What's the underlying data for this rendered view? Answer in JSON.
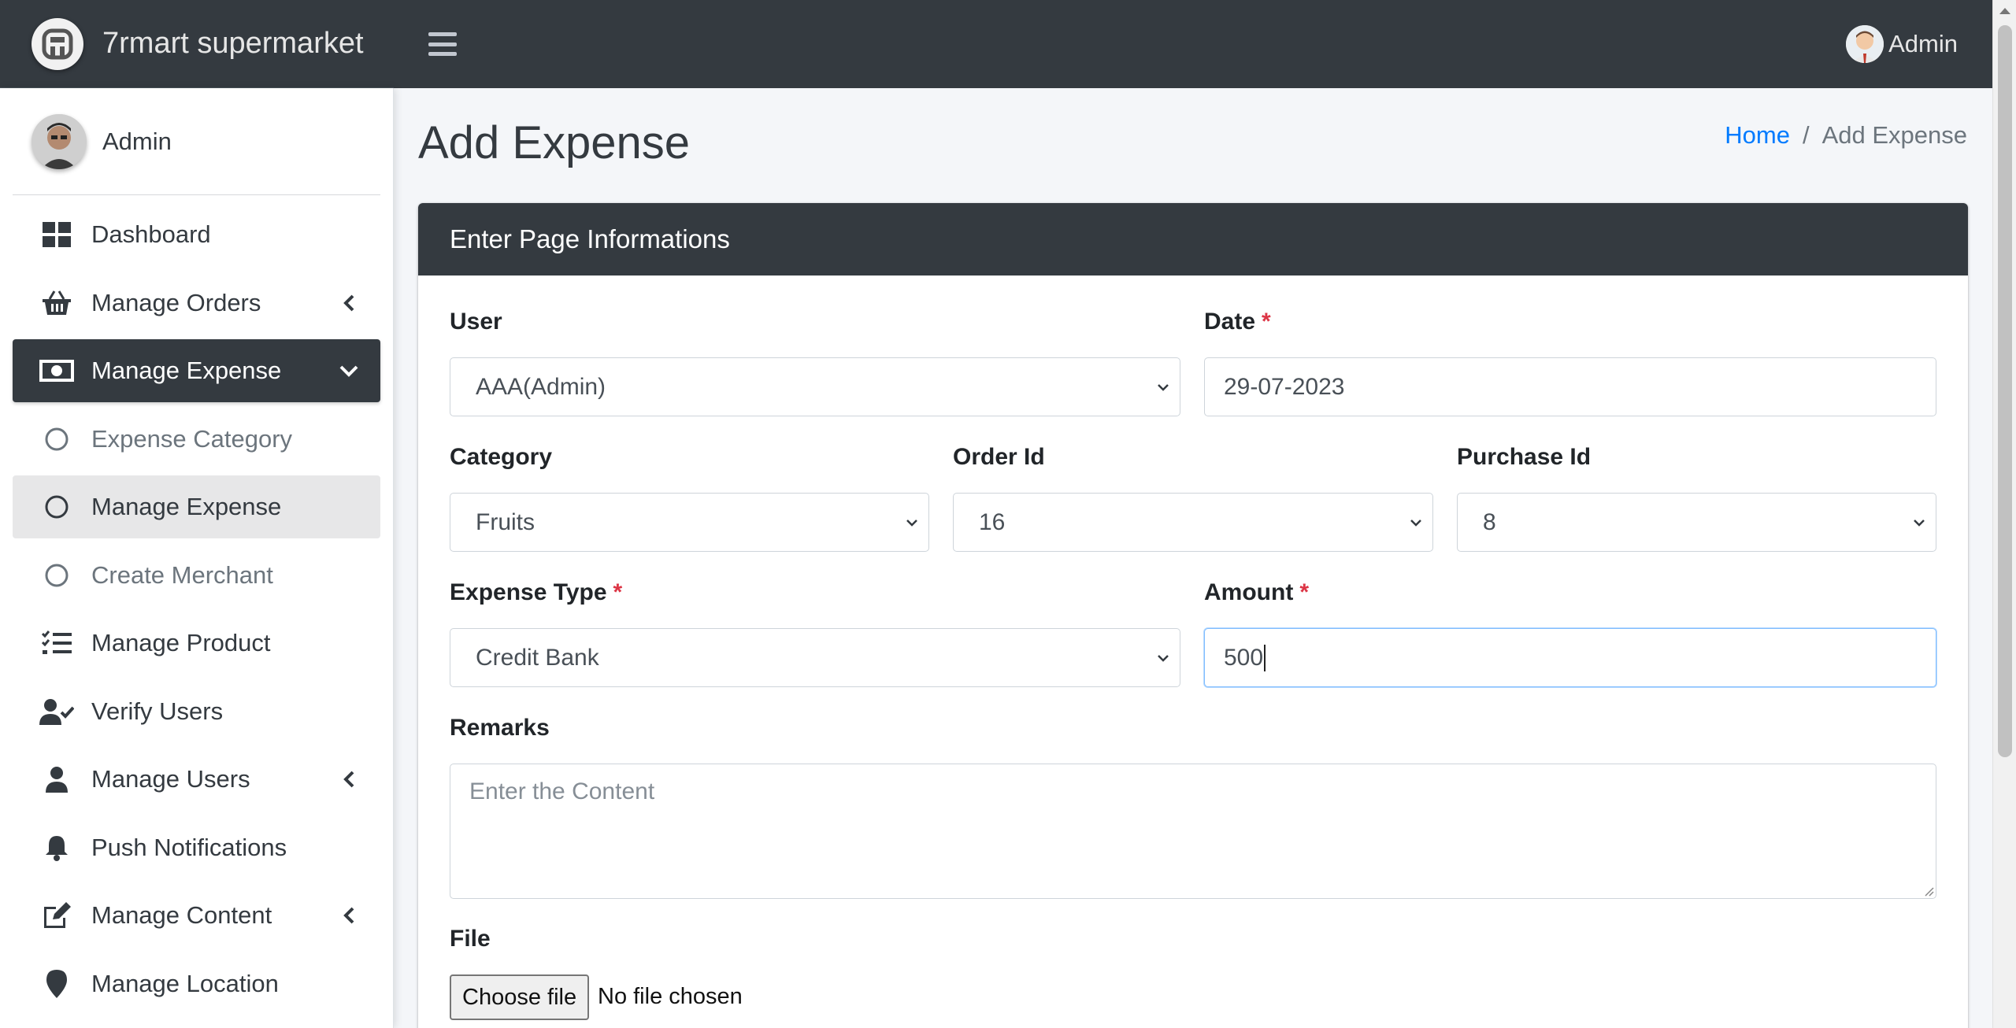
{
  "brand": {
    "name": "7rmart supermarket"
  },
  "topbar": {
    "user_name": "Admin"
  },
  "sidebar": {
    "user_name": "Admin",
    "items": [
      {
        "label": "Dashboard",
        "icon": "dashboard-icon"
      },
      {
        "label": "Manage Orders",
        "icon": "basket-icon"
      },
      {
        "label": "Manage Expense",
        "icon": "money-bill-icon"
      },
      {
        "label": "Expense Category",
        "icon": "circle-icon"
      },
      {
        "label": "Manage Expense",
        "icon": "circle-icon"
      },
      {
        "label": "Create Merchant",
        "icon": "circle-icon"
      },
      {
        "label": "Manage Product",
        "icon": "list-check-icon"
      },
      {
        "label": "Verify Users",
        "icon": "user-check-icon"
      },
      {
        "label": "Manage Users",
        "icon": "user-icon"
      },
      {
        "label": "Push Notifications",
        "icon": "bell-icon"
      },
      {
        "label": "Manage Content",
        "icon": "edit-icon"
      },
      {
        "label": "Manage Location",
        "icon": "map-marker-icon"
      }
    ]
  },
  "page": {
    "title": "Add Expense",
    "breadcrumb": {
      "home": "Home",
      "separator": "/",
      "current": "Add Expense"
    }
  },
  "form": {
    "header": "Enter Page Informations",
    "user": {
      "label": "User",
      "value": "AAA(Admin)"
    },
    "date": {
      "label": "Date",
      "required": "*",
      "value": "29-07-2023"
    },
    "category": {
      "label": "Category",
      "value": "Fruits"
    },
    "order_id": {
      "label": "Order Id",
      "value": "16"
    },
    "purchase_id": {
      "label": "Purchase Id",
      "value": "8"
    },
    "expense_type": {
      "label": "Expense Type",
      "required": "*",
      "value": "Credit Bank"
    },
    "amount": {
      "label": "Amount",
      "required": "*",
      "value": "500"
    },
    "remarks": {
      "label": "Remarks",
      "placeholder": "Enter the Content"
    },
    "file": {
      "label": "File",
      "button": "Choose file",
      "status": "No file chosen"
    }
  },
  "colors": {
    "topbar": "#343a40",
    "active_nav": "#343a40",
    "link": "#007bff",
    "required": "#dc3545",
    "focus_border": "#80bdff"
  }
}
